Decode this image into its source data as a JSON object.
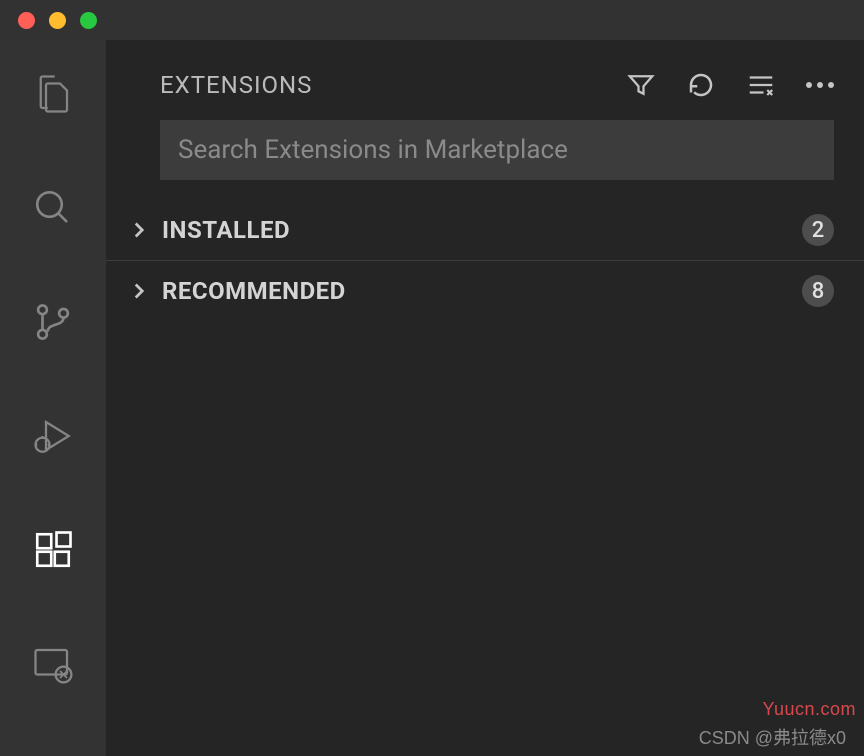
{
  "sidebar": {
    "title": "EXTENSIONS",
    "search_placeholder": "Search Extensions in Marketplace",
    "sections": {
      "installed": {
        "label": "INSTALLED",
        "count": "2"
      },
      "recommended": {
        "label": "RECOMMENDED",
        "count": "8"
      }
    }
  },
  "watermarks": {
    "right": "Yuucn.com",
    "bottom": "CSDN @弗拉德x0"
  }
}
